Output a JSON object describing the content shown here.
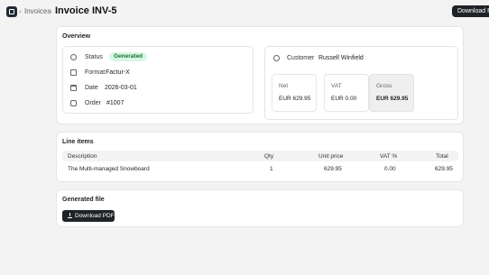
{
  "breadcrumb": {
    "separator": "›",
    "invoices": "Invoices",
    "title": "Invoice INV-5"
  },
  "header": {
    "download_label": "Download PDF"
  },
  "overview": {
    "title": "Overview",
    "status_label": "Status",
    "status_value": "Generated",
    "format_label": "Format",
    "format_value": "Factur-X",
    "date_label": "Date",
    "date_value": "2026-03-01",
    "order_label": "Order",
    "order_value": "#1007",
    "customer_label": "Customer",
    "customer_value": "Russell Winfield",
    "totals": [
      {
        "label": "Net",
        "value": "EUR 629.95"
      },
      {
        "label": "VAT",
        "value": "EUR 0.00"
      },
      {
        "label": "Gross",
        "value": "EUR 629.95"
      }
    ]
  },
  "line_items": {
    "title": "Line items",
    "columns": [
      "Description",
      "Qty",
      "Unit price",
      "VAT %",
      "Total"
    ],
    "rows": [
      {
        "description": "The Multi-managed Snowboard",
        "qty": "1",
        "unit_price": "629.95",
        "vat": "0.00",
        "total": "629.95"
      }
    ]
  },
  "generated_file": {
    "title": "Generated file",
    "download_label": "Download PDF"
  },
  "colors": {
    "background": "#f3f3f4",
    "accent_dark": "#1f2328",
    "status_bg": "#d9f7e2",
    "status_text": "#12733a",
    "link": "#2356d8"
  }
}
